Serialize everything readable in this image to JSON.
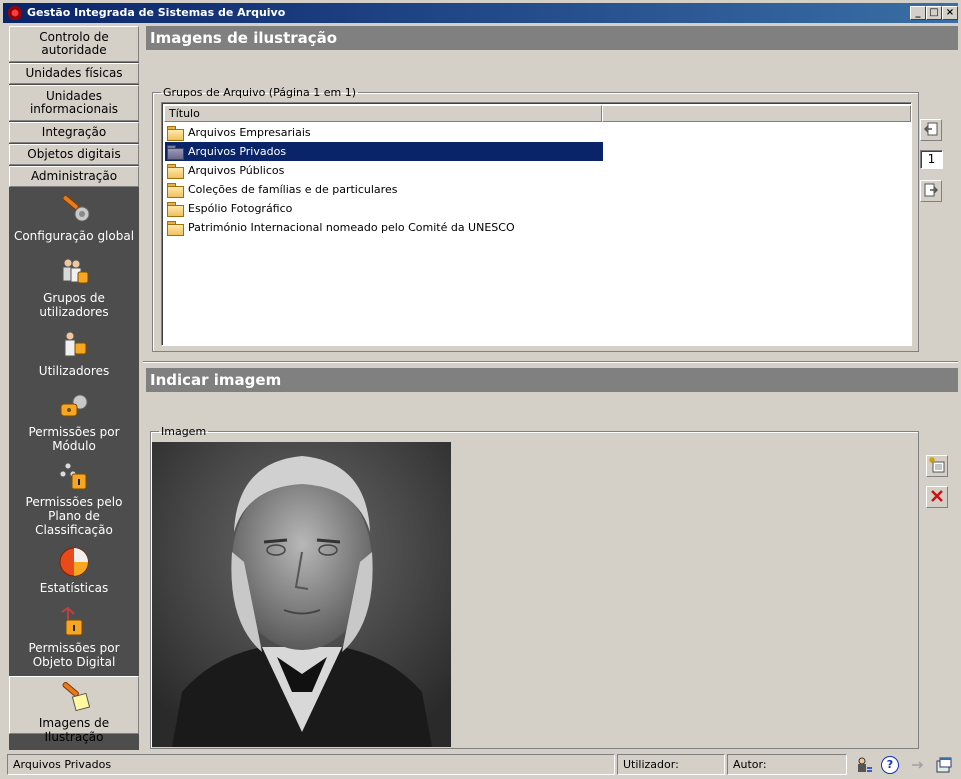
{
  "window": {
    "title": "Gestão Integrada de Sistemas de Arquivo",
    "minimize": "_",
    "maximize": "□",
    "close": "×"
  },
  "nav": {
    "tabs": [
      "Controlo de autoridade",
      "Unidades físicas",
      "Unidades informacionais",
      "Integração",
      "Objetos digitais",
      "Administração"
    ],
    "items": [
      "Configuração global",
      "Grupos de utilizadores",
      "Utilizadores",
      "Permissões por Módulo",
      "Permissões pelo Plano de Classificação",
      "Estatísticas",
      "Permissões por Objeto Digital",
      "Imagens de Ilustração"
    ],
    "selected": "Imagens de Ilustração"
  },
  "illustrations_panel": {
    "title": "Imagens de ilustração",
    "group_legend": "Grupos de Arquivo (Página 1 em 1)",
    "column_header": "Título",
    "rows": [
      "Arquivos Empresariais",
      "Arquivos Privados",
      "Arquivos Públicos",
      "Coleções de famílias e de particulares",
      "Espólio Fotográfico",
      "Património Internacional nomeado pelo Comité da UNESCO"
    ],
    "selected_row": "Arquivos Privados",
    "page_number": "1"
  },
  "image_panel": {
    "title": "Indicar imagem",
    "image_legend": "Imagem"
  },
  "status": {
    "item": "Arquivos Privados",
    "user_label": "Utilizador:",
    "author_label": "Autor:",
    "help_symbol": "?"
  },
  "colors": {
    "titlebar": "#0a246a",
    "selection": "#0a246a",
    "panel_header": "#808080",
    "nav_background": "#4d4d4d",
    "face": "#d4d0c8"
  }
}
